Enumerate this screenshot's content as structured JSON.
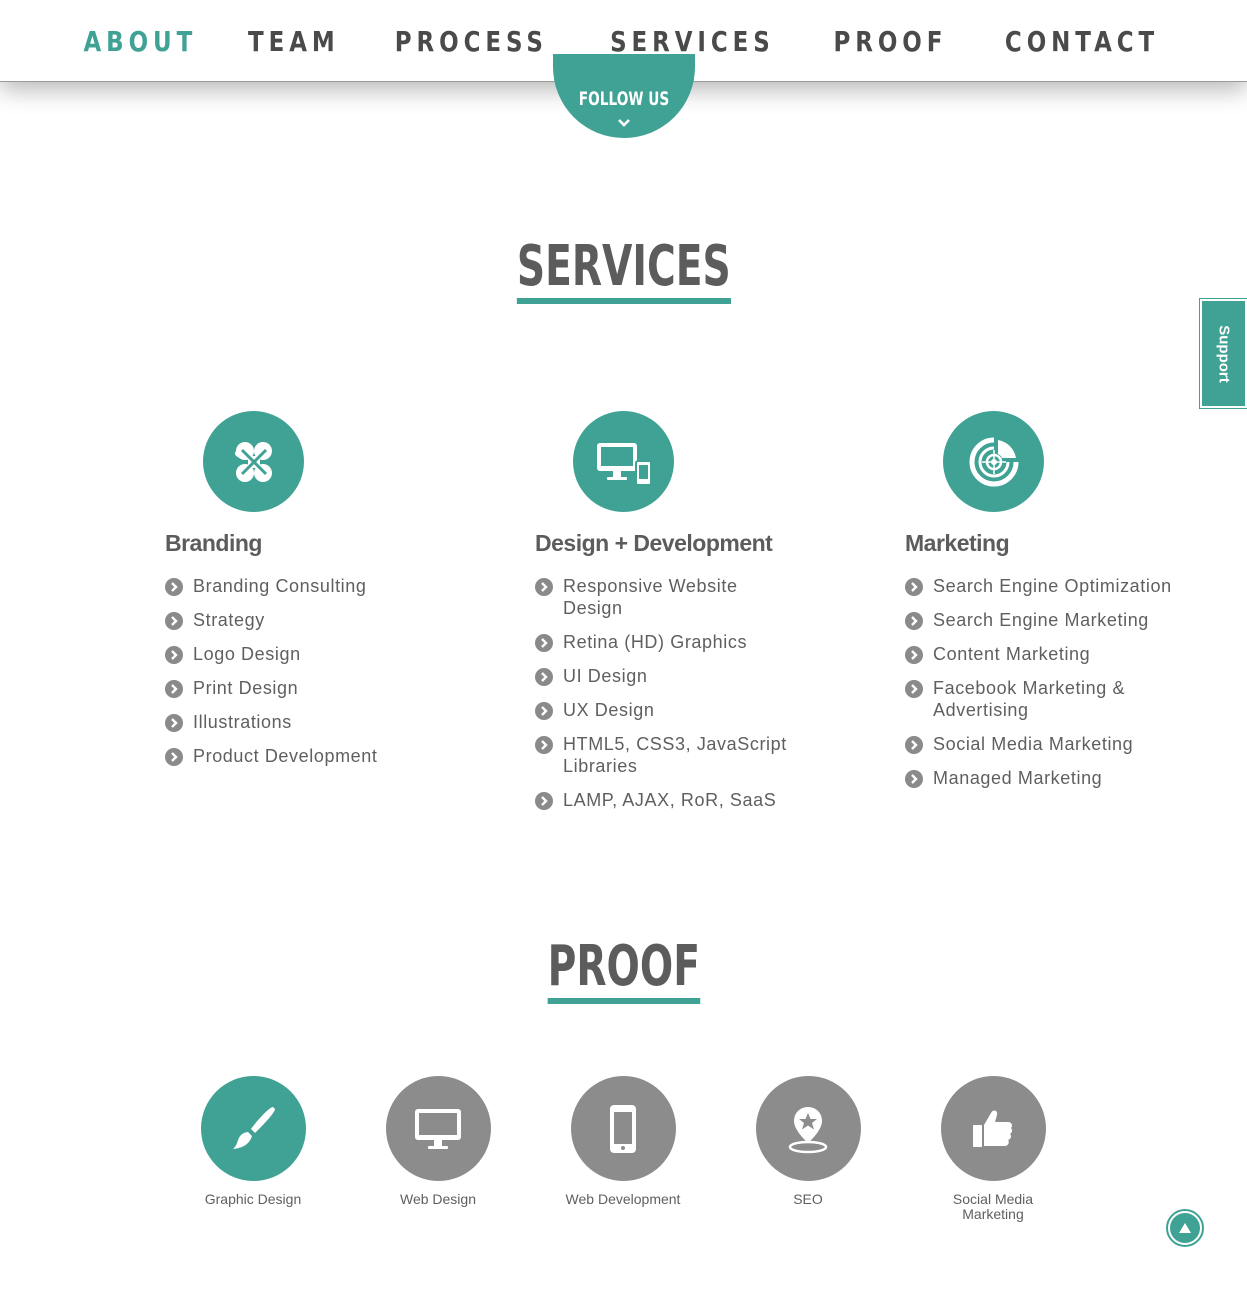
{
  "nav": {
    "items": [
      {
        "label": "ABOUT",
        "active": true
      },
      {
        "label": "TEAM",
        "active": false
      },
      {
        "label": "PROCESS",
        "active": false
      },
      {
        "label": "SERVICES",
        "active": false
      },
      {
        "label": "PROOF",
        "active": false
      },
      {
        "label": "CONTACT",
        "active": false
      }
    ],
    "follow_label": "FOLLOW US"
  },
  "support_label": "Support",
  "services": {
    "title": "SERVICES",
    "columns": [
      {
        "icon": "clover-icon",
        "heading": "Branding",
        "items": [
          "Branding Consulting",
          "Strategy",
          "Logo Design",
          "Print Design",
          "Illustrations",
          "Product Development"
        ]
      },
      {
        "icon": "devices-icon",
        "heading": "Design + Development",
        "items": [
          "Responsive Website Design",
          "Retina (HD) Graphics",
          "UI Design",
          "UX Design",
          "HTML5, CSS3, JavaScript Libraries",
          "LAMP, AJAX, RoR, SaaS"
        ]
      },
      {
        "icon": "target-icon",
        "heading": "Marketing",
        "items": [
          "Search Engine Optimization",
          "Search Engine Marketing",
          "Content Marketing",
          "Facebook Marketing & Advertising",
          "Social Media Marketing",
          "Managed Marketing"
        ]
      }
    ]
  },
  "proof": {
    "title": "PROOF",
    "items": [
      {
        "icon": "paintbrush-icon",
        "label": "Graphic Design",
        "active": true
      },
      {
        "icon": "monitor-icon",
        "label": "Web Design",
        "active": false
      },
      {
        "icon": "smartphone-icon",
        "label": "Web Development",
        "active": false
      },
      {
        "icon": "map-pin-star-icon",
        "label": "SEO",
        "active": false
      },
      {
        "icon": "thumbs-up-icon",
        "label": "Social Media Marketing",
        "active": false
      }
    ]
  },
  "colors": {
    "accent": "#3fa294",
    "text": "#5f5f5f",
    "inactive_circle": "#8c8c8c"
  }
}
